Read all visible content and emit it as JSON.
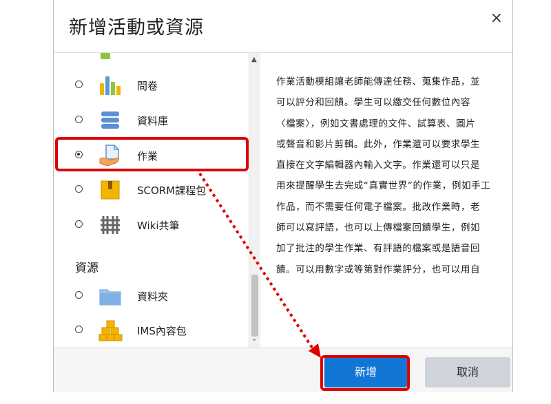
{
  "dialog": {
    "title": "新增活動或資源",
    "close_label": "×"
  },
  "list": {
    "items": [
      {
        "label": "問卷",
        "icon": "bar-chart-icon",
        "checked": false
      },
      {
        "label": "資料庫",
        "icon": "database-icon",
        "checked": false
      },
      {
        "label": "作業",
        "icon": "assignment-icon",
        "checked": true
      },
      {
        "label": "SCORM課程包",
        "icon": "package-box-icon",
        "checked": false
      },
      {
        "label": "Wiki共筆",
        "icon": "wiki-icon",
        "checked": false
      }
    ],
    "section_resources": "資源",
    "resources": [
      {
        "label": "資料夾",
        "icon": "folder-icon",
        "checked": false
      },
      {
        "label": "IMS內容包",
        "icon": "stacked-boxes-icon",
        "checked": false
      }
    ]
  },
  "description": {
    "lines": [
      "作業活動模組讓老師能傳達任務、蒐集作品，並",
      "可以評分和回饋。學生可以繳交任何數位內容",
      "〈檔案〉，例如文書處理的文件、試算表、圖片",
      "或聲音和影片剪輯。此外，作業還可以要求學生",
      "直接在文字編輯器內輸入文字。作業還可以只是",
      "用來提醒學生去完成“真實世界”的作業，例如手工",
      "作品，而不需要任何電子檔案。批改作業時，老",
      "師可以寫評語，也可以上傳檔案回饋學生，例如",
      "加了批注的學生作業、有評語的檔案或是語音回",
      "饋。可以用數字或等第對作業評分，也可以用自"
    ]
  },
  "footer": {
    "add_label": "新增",
    "cancel_label": "取消"
  },
  "colors": {
    "primary": "#1176d4",
    "highlight": "#e00000",
    "cancel": "#ced4da"
  }
}
